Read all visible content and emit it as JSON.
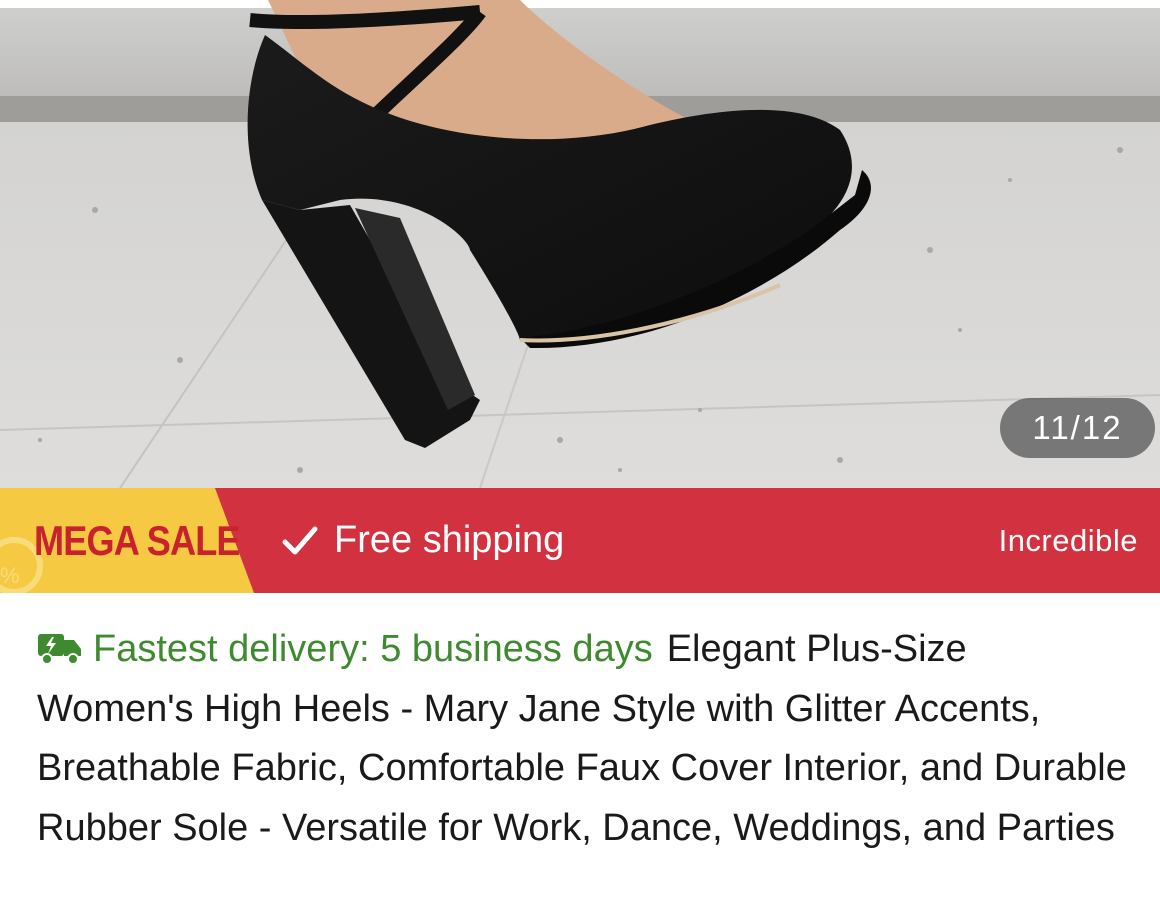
{
  "gallery": {
    "counter": "11/12",
    "image_icon": "product-photo-black-heel"
  },
  "banner": {
    "mega_sale_label": "MEGA SALE",
    "free_shipping_label": "Free shipping",
    "incredible_label": "Incredible",
    "check_icon": "check-icon",
    "colors": {
      "banner_red": "#d2313f",
      "mega_yellow": "#f6c943",
      "mega_text": "#c8222e"
    }
  },
  "product": {
    "delivery_icon": "truck-icon",
    "delivery_text": "Fastest delivery: 5 business days",
    "delivery_color": "#3e8a2f",
    "title": "Elegant Plus-Size Women's High Heels - Mary Jane Style with Glitter Accents, Breathable Fabric, Comfortable Faux Cover Interior, and Durable Rubber Sole - Versatile for Work, Dance, Weddings, and Parties"
  }
}
